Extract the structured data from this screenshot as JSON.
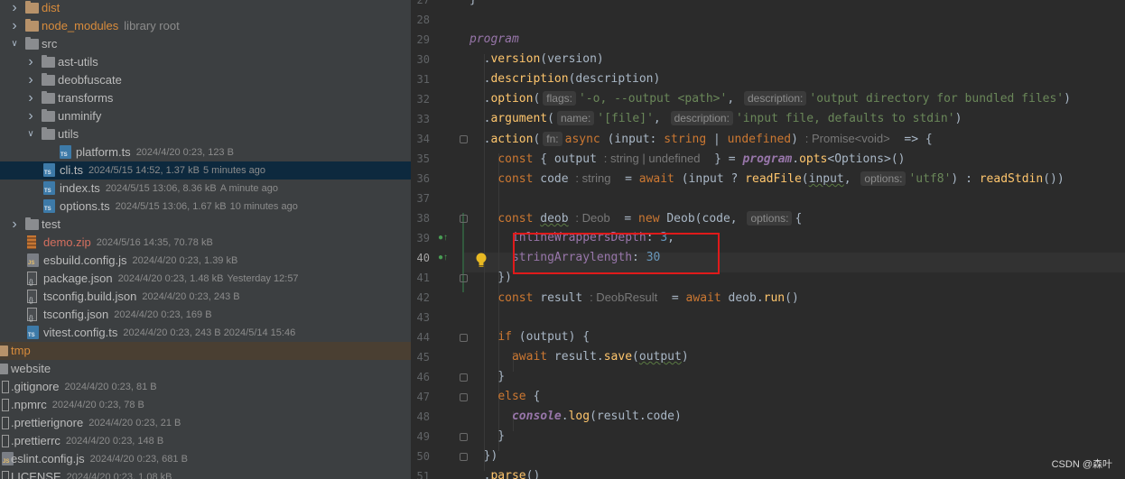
{
  "project_tree": {
    "items": [
      {
        "name": "dist",
        "meta": "",
        "note": "",
        "kind": "folder",
        "color": "orange",
        "indent": 0,
        "expanded": false
      },
      {
        "name": "node_modules",
        "meta": "",
        "note": "library root",
        "kind": "folder",
        "color": "orange",
        "indent": 0,
        "expanded": false
      },
      {
        "name": "src",
        "meta": "",
        "note": "",
        "kind": "folder",
        "color": "plain",
        "indent": 0,
        "expanded": true
      },
      {
        "name": "ast-utils",
        "meta": "",
        "note": "",
        "kind": "folder",
        "color": "plain",
        "indent": 1,
        "expanded": false
      },
      {
        "name": "deobfuscate",
        "meta": "",
        "note": "",
        "kind": "folder",
        "color": "plain",
        "indent": 1,
        "expanded": false
      },
      {
        "name": "transforms",
        "meta": "",
        "note": "",
        "kind": "folder",
        "color": "plain",
        "indent": 1,
        "expanded": false
      },
      {
        "name": "unminify",
        "meta": "",
        "note": "",
        "kind": "folder",
        "color": "plain",
        "indent": 1,
        "expanded": false
      },
      {
        "name": "utils",
        "meta": "",
        "note": "",
        "kind": "folder",
        "color": "plain",
        "indent": 1,
        "expanded": true
      },
      {
        "name": "platform.ts",
        "meta": "2024/4/20 0:23, 123 B",
        "note": "",
        "kind": "ts",
        "color": "plain",
        "indent": 2
      },
      {
        "name": "cli.ts",
        "meta": "2024/5/15 14:52, 1.37 kB",
        "note": "5 minutes ago",
        "kind": "ts",
        "color": "plain",
        "indent": 1,
        "selected": true
      },
      {
        "name": "index.ts",
        "meta": "2024/5/15 13:06, 8.36 kB",
        "note": "A minute ago",
        "kind": "ts",
        "color": "plain",
        "indent": 1
      },
      {
        "name": "options.ts",
        "meta": "2024/5/15 13:06, 1.67 kB",
        "note": "10 minutes ago",
        "kind": "ts",
        "color": "plain",
        "indent": 1
      },
      {
        "name": "test",
        "meta": "",
        "note": "",
        "kind": "folder",
        "color": "plain",
        "indent": 0,
        "expanded": false
      },
      {
        "name": "demo.zip",
        "meta": "2024/5/16 14:35, 70.78 kB",
        "note": "",
        "kind": "zip",
        "color": "red",
        "indent": 0
      },
      {
        "name": "esbuild.config.js",
        "meta": "2024/4/20 0:23, 1.39 kB",
        "note": "",
        "kind": "js",
        "color": "plain",
        "indent": 0
      },
      {
        "name": "package.json",
        "meta": "2024/4/20 0:23, 1.48 kB",
        "note": "Yesterday 12:57",
        "kind": "json",
        "color": "plain",
        "indent": 0
      },
      {
        "name": "tsconfig.build.json",
        "meta": "2024/4/20 0:23, 243 B",
        "note": "",
        "kind": "json",
        "color": "plain",
        "indent": 0
      },
      {
        "name": "tsconfig.json",
        "meta": "2024/4/20 0:23, 169 B",
        "note": "",
        "kind": "json",
        "color": "plain",
        "indent": 0
      },
      {
        "name": "vitest.config.ts",
        "meta": "2024/4/20 0:23, 243 B 2024/5/14 15:46",
        "note": "",
        "kind": "ts",
        "color": "plain",
        "indent": 0
      },
      {
        "name": "tmp",
        "meta": "",
        "note": "",
        "kind": "folder",
        "color": "orange",
        "indent": -1,
        "highlighted": true
      },
      {
        "name": "website",
        "meta": "",
        "note": "",
        "kind": "folder",
        "color": "plain",
        "indent": -1
      },
      {
        "name": ".gitignore",
        "meta": "2024/4/20 0:23, 81 B",
        "note": "",
        "kind": "dot",
        "color": "plain",
        "indent": -1
      },
      {
        "name": ".npmrc",
        "meta": "2024/4/20 0:23, 78 B",
        "note": "",
        "kind": "dot",
        "color": "plain",
        "indent": -1
      },
      {
        "name": ".prettierignore",
        "meta": "2024/4/20 0:23, 21 B",
        "note": "",
        "kind": "dot",
        "color": "plain",
        "indent": -1
      },
      {
        "name": ".prettierrc",
        "meta": "2024/4/20 0:23, 148 B",
        "note": "",
        "kind": "dot",
        "color": "plain",
        "indent": -1
      },
      {
        "name": "eslint.config.js",
        "meta": "2024/4/20 0:23, 681 B",
        "note": "",
        "kind": "js",
        "color": "plain",
        "indent": -1
      },
      {
        "name": "LICENSE",
        "meta": "2024/4/20 0:23, 1.08 kB",
        "note": "",
        "kind": "dot",
        "color": "plain",
        "indent": -1
      }
    ]
  },
  "editor": {
    "first_line": 27,
    "current_line": 40,
    "gutter_marks": {
      "39": "override-icon",
      "40": "override-icon"
    },
    "lines": [
      [
        {
          "t": "}",
          "c": ""
        }
      ],
      [],
      [
        {
          "t": "program",
          "c": "purp"
        }
      ],
      [
        {
          "t": "  .",
          "c": ""
        },
        {
          "t": "version",
          "c": "fn"
        },
        {
          "t": "(version)",
          "c": ""
        }
      ],
      [
        {
          "t": "  .",
          "c": ""
        },
        {
          "t": "description",
          "c": "fn"
        },
        {
          "t": "(description)",
          "c": ""
        }
      ],
      [
        {
          "t": "  .",
          "c": ""
        },
        {
          "t": "option",
          "c": "fn"
        },
        {
          "t": "(",
          "c": ""
        },
        {
          "t": "flags:",
          "c": "inlay"
        },
        {
          "t": "'-o, --output <path>'",
          "c": "str"
        },
        {
          "t": ", ",
          "c": ""
        },
        {
          "t": "description:",
          "c": "inlay"
        },
        {
          "t": "'output directory for bundled files'",
          "c": "str"
        },
        {
          "t": ")",
          "c": ""
        }
      ],
      [
        {
          "t": "  .",
          "c": ""
        },
        {
          "t": "argument",
          "c": "fn"
        },
        {
          "t": "(",
          "c": ""
        },
        {
          "t": "name:",
          "c": "inlay"
        },
        {
          "t": "'[file]'",
          "c": "str"
        },
        {
          "t": ", ",
          "c": ""
        },
        {
          "t": "description:",
          "c": "inlay"
        },
        {
          "t": "'input file, defaults to stdin'",
          "c": "str"
        },
        {
          "t": ")",
          "c": ""
        }
      ],
      [
        {
          "t": "  .",
          "c": ""
        },
        {
          "t": "action",
          "c": "fn"
        },
        {
          "t": "(",
          "c": ""
        },
        {
          "t": "fn:",
          "c": "inlay"
        },
        {
          "t": "async ",
          "c": "kw"
        },
        {
          "t": "(input: ",
          "c": ""
        },
        {
          "t": "string",
          "c": "kw"
        },
        {
          "t": " | ",
          "c": ""
        },
        {
          "t": "undefined",
          "c": "kw"
        },
        {
          "t": ") ",
          "c": ""
        },
        {
          "t": ": Promise<void>",
          "c": "hint"
        },
        {
          "t": "  => {",
          "c": ""
        }
      ],
      [
        {
          "t": "    ",
          "c": ""
        },
        {
          "t": "const",
          "c": "kw"
        },
        {
          "t": " { output ",
          "c": ""
        },
        {
          "t": ": string | undefined",
          "c": "hint"
        },
        {
          "t": "  } = ",
          "c": ""
        },
        {
          "t": "program",
          "c": "glob"
        },
        {
          "t": ".",
          "c": ""
        },
        {
          "t": "opts",
          "c": "fn"
        },
        {
          "t": "<Options>()",
          "c": ""
        }
      ],
      [
        {
          "t": "    ",
          "c": ""
        },
        {
          "t": "const",
          "c": "kw"
        },
        {
          "t": " code ",
          "c": ""
        },
        {
          "t": ": string",
          "c": "hint"
        },
        {
          "t": "  = ",
          "c": ""
        },
        {
          "t": "await",
          "c": "kw"
        },
        {
          "t": " (input ? ",
          "c": ""
        },
        {
          "t": "readFile",
          "c": "fn"
        },
        {
          "t": "(",
          "c": ""
        },
        {
          "t": "input",
          "c": "wavy"
        },
        {
          "t": ", ",
          "c": ""
        },
        {
          "t": "options:",
          "c": "inlay"
        },
        {
          "t": "'utf8'",
          "c": "str"
        },
        {
          "t": ") : ",
          "c": ""
        },
        {
          "t": "readStdin",
          "c": "fn"
        },
        {
          "t": "())",
          "c": ""
        }
      ],
      [],
      [
        {
          "t": "    ",
          "c": ""
        },
        {
          "t": "const",
          "c": "kw"
        },
        {
          "t": " ",
          "c": ""
        },
        {
          "t": "deob",
          "c": "wavy"
        },
        {
          "t": " ",
          "c": ""
        },
        {
          "t": ": Deob",
          "c": "hint"
        },
        {
          "t": "  = ",
          "c": ""
        },
        {
          "t": "new",
          "c": "kw"
        },
        {
          "t": " Deob(code, ",
          "c": ""
        },
        {
          "t": "options:",
          "c": "inlay"
        },
        {
          "t": "{",
          "c": ""
        }
      ],
      [
        {
          "t": "      ",
          "c": ""
        },
        {
          "t": "inlineWrappersDepth",
          "c": "prop"
        },
        {
          "t": ": ",
          "c": ""
        },
        {
          "t": "3",
          "c": "num"
        },
        {
          "t": ",",
          "c": ""
        }
      ],
      [
        {
          "t": "      ",
          "c": ""
        },
        {
          "t": "stringArraylength",
          "c": "prop"
        },
        {
          "t": ": ",
          "c": ""
        },
        {
          "t": "30",
          "c": "num"
        }
      ],
      [
        {
          "t": "    })",
          "c": ""
        }
      ],
      [
        {
          "t": "    ",
          "c": ""
        },
        {
          "t": "const",
          "c": "kw"
        },
        {
          "t": " result ",
          "c": ""
        },
        {
          "t": ": DeobResult",
          "c": "hint"
        },
        {
          "t": "  = ",
          "c": ""
        },
        {
          "t": "await",
          "c": "kw"
        },
        {
          "t": " deob.",
          "c": ""
        },
        {
          "t": "run",
          "c": "fn"
        },
        {
          "t": "()",
          "c": ""
        }
      ],
      [],
      [
        {
          "t": "    ",
          "c": ""
        },
        {
          "t": "if",
          "c": "kw"
        },
        {
          "t": " (output) {",
          "c": ""
        }
      ],
      [
        {
          "t": "      ",
          "c": ""
        },
        {
          "t": "await",
          "c": "kw"
        },
        {
          "t": " result.",
          "c": ""
        },
        {
          "t": "save",
          "c": "fn"
        },
        {
          "t": "(",
          "c": ""
        },
        {
          "t": "output",
          "c": "wavy"
        },
        {
          "t": ")",
          "c": ""
        }
      ],
      [
        {
          "t": "    }",
          "c": ""
        }
      ],
      [
        {
          "t": "    ",
          "c": ""
        },
        {
          "t": "else",
          "c": "kw"
        },
        {
          "t": " {",
          "c": ""
        }
      ],
      [
        {
          "t": "      ",
          "c": ""
        },
        {
          "t": "console",
          "c": "glob"
        },
        {
          "t": ".",
          "c": ""
        },
        {
          "t": "log",
          "c": "fn"
        },
        {
          "t": "(result.code)",
          "c": ""
        }
      ],
      [
        {
          "t": "    }",
          "c": ""
        }
      ],
      [
        {
          "t": "  })",
          "c": ""
        }
      ],
      [
        {
          "t": "  .",
          "c": ""
        },
        {
          "t": "parse",
          "c": "fn"
        },
        {
          "t": "()",
          "c": ""
        }
      ]
    ]
  },
  "watermark": "CSDN @森叶",
  "colors": {
    "accent_red": "#e01a1a",
    "selection": "#0d293e",
    "highlight": "#4a3f32"
  }
}
